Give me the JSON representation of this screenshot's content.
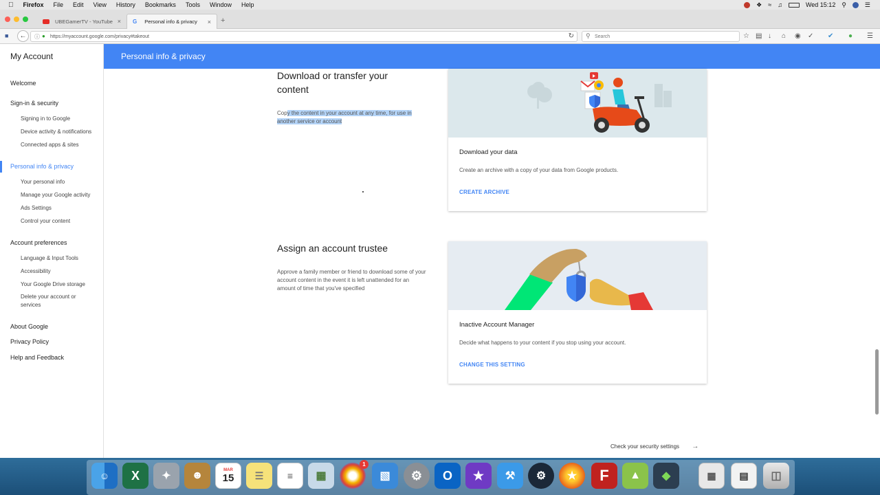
{
  "menubar": {
    "app_name": "Firefox",
    "items": [
      "File",
      "Edit",
      "View",
      "History",
      "Bookmarks",
      "Tools",
      "Window",
      "Help"
    ],
    "clock": "Wed 15:12"
  },
  "tabs": [
    {
      "label": "UBEGamerTV - YouTube",
      "active": false
    },
    {
      "label": "Personal info & privacy",
      "active": true
    }
  ],
  "address": {
    "url": "https://myaccount.google.com/privacy#takeout",
    "search_placeholder": "Search"
  },
  "sidebar": {
    "title": "My Account",
    "welcome": "Welcome",
    "signin_header": "Sign-in & security",
    "signin_items": [
      "Signing in to Google",
      "Device activity & notifications",
      "Connected apps & sites"
    ],
    "privacy_header": "Personal info & privacy",
    "privacy_items": [
      "Your personal info",
      "Manage your Google activity",
      "Ads Settings",
      "Control your content"
    ],
    "prefs_header": "Account preferences",
    "prefs_items": [
      "Language & Input Tools",
      "Accessibility",
      "Your Google Drive storage",
      "Delete your account or services"
    ],
    "about": "About Google",
    "privacy_policy": "Privacy Policy",
    "help": "Help and Feedback"
  },
  "header": {
    "title": "Personal info & privacy"
  },
  "sections": {
    "download": {
      "title": "Download or transfer your content",
      "desc_pre": "Cop",
      "desc_hl": "y the content in your account at any time, for use in another service or account",
      "card_title": "Download your data",
      "card_desc": "Create an archive with a copy of your data from Google products.",
      "card_link": "CREATE ARCHIVE"
    },
    "trustee": {
      "title": "Assign an account trustee",
      "desc": "Approve a family member or friend to download some of your account content in the event it is left unattended for an amount of time that you've specified",
      "card_title": "Inactive Account Manager",
      "card_desc": "Decide what happens to your content if you stop using your account.",
      "card_link": "CHANGE THIS SETTING"
    }
  },
  "footer": {
    "link": "Check your security settings"
  },
  "colors": {
    "accent": "#4285f4",
    "illustration_bg": "#dce8ec"
  },
  "dock": {
    "apps": [
      "finder",
      "excel",
      "launchpad",
      "contacts",
      "calendar",
      "notes",
      "reminders",
      "preview",
      "photos",
      "keynote",
      "system-preferences",
      "outlook",
      "imovie",
      "xcode",
      "steam",
      "firefox",
      "filezilla",
      "android-studio",
      "android-file",
      "activity",
      "screenshots",
      "trash"
    ],
    "calendar_date": "15",
    "calendar_month": "MAR",
    "photos_badge": "1"
  }
}
